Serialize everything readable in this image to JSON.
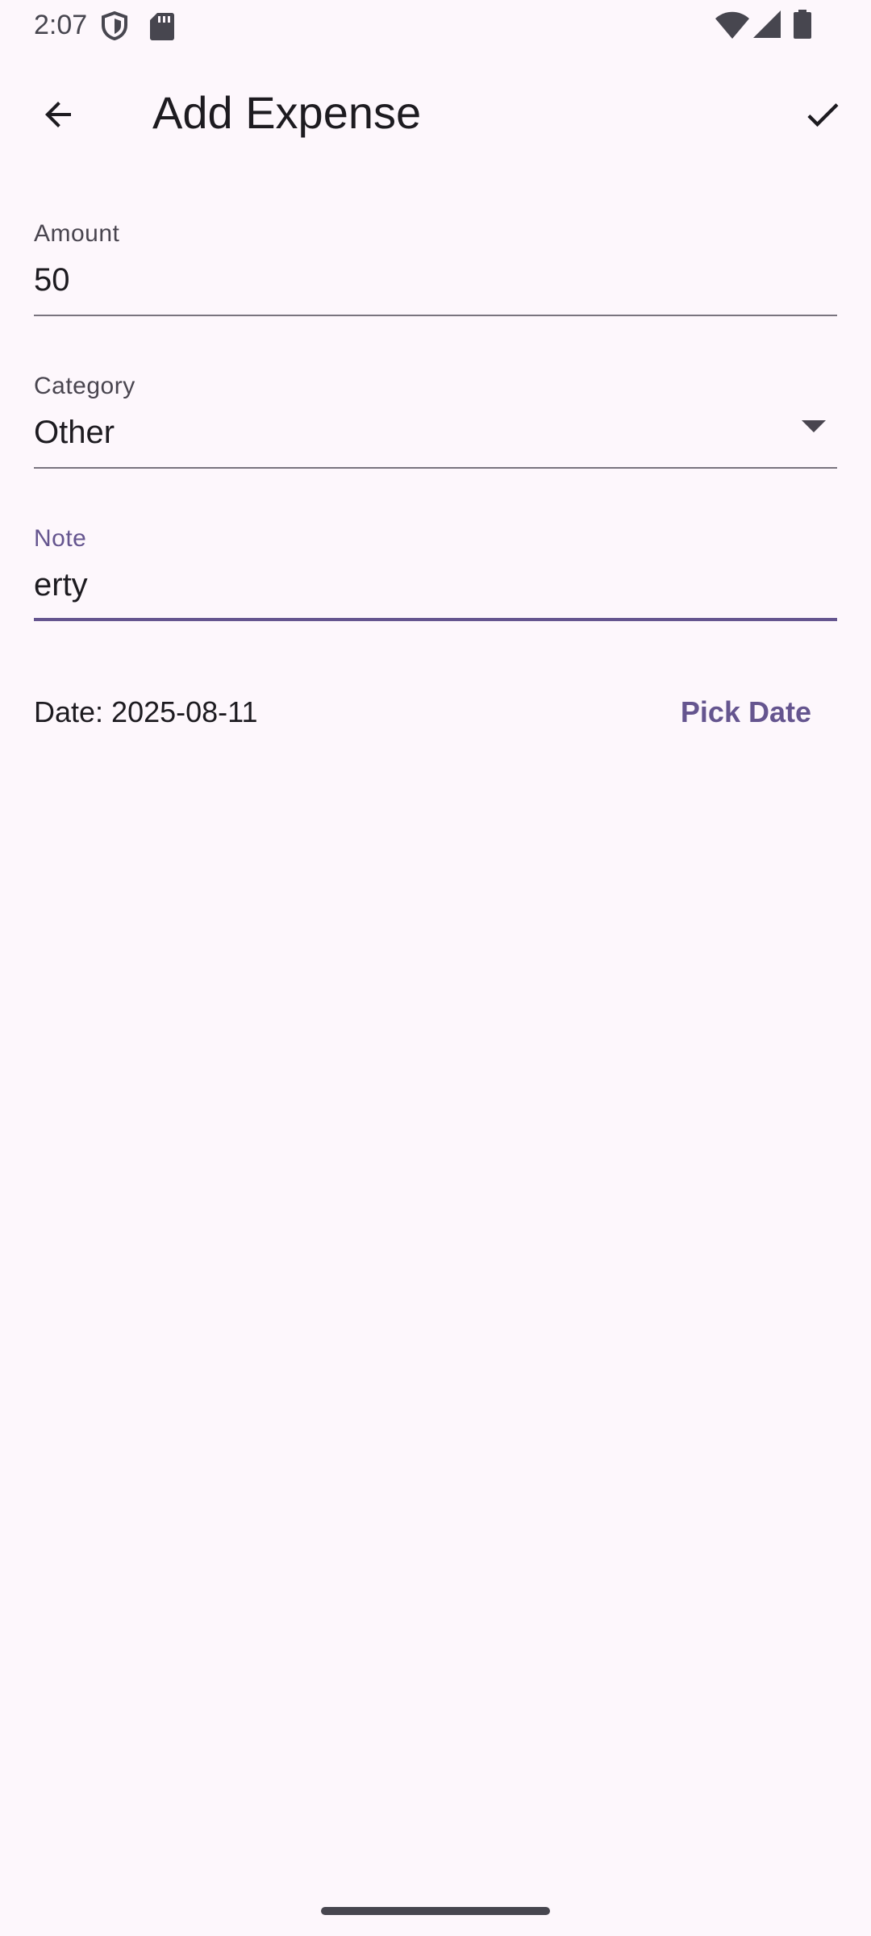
{
  "status_bar": {
    "time": "2:07",
    "icons": [
      "shield-icon",
      "sd-card-icon",
      "wifi-icon",
      "signal-icon",
      "battery-icon"
    ]
  },
  "app_bar": {
    "title": "Add Expense",
    "back_icon": "arrow-back-icon",
    "save_icon": "check-icon"
  },
  "form": {
    "amount": {
      "label": "Amount",
      "value": "50"
    },
    "category": {
      "label": "Category",
      "value": "Other"
    },
    "note": {
      "label": "Note",
      "value": "erty",
      "focused": true
    },
    "date": {
      "text": "Date: 2025-08-11",
      "pick_label": "Pick Date"
    }
  },
  "colors": {
    "background": "#fdf7fc",
    "primary": "#65558f",
    "text": "#1d1b20",
    "label": "#49454f",
    "underline": "#79747e"
  }
}
